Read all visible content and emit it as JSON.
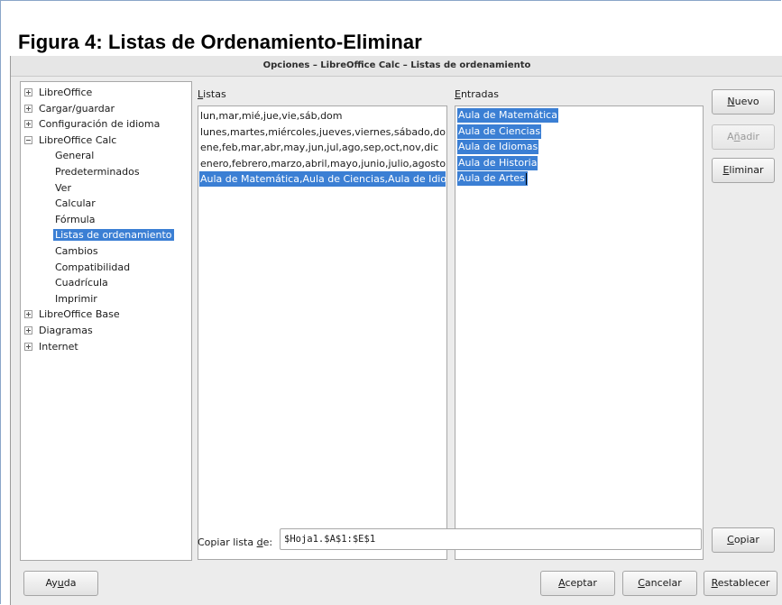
{
  "caption": "Figura 4: Listas de Ordenamiento-Eliminar",
  "window": {
    "title": "Opciones – LibreOffice Calc – Listas de ordenamiento"
  },
  "tree": {
    "items": [
      {
        "label": "LibreOffice",
        "expander": "plus"
      },
      {
        "label": "Cargar/guardar",
        "expander": "plus"
      },
      {
        "label": "Configuración de idioma",
        "expander": "plus"
      },
      {
        "label": "LibreOffice Calc",
        "expander": "minus"
      },
      {
        "label": "General"
      },
      {
        "label": "Predeterminados"
      },
      {
        "label": "Ver"
      },
      {
        "label": "Calcular"
      },
      {
        "label": "Fórmula"
      },
      {
        "label": "Listas de ordenamiento",
        "selected": true
      },
      {
        "label": "Cambios"
      },
      {
        "label": "Compatibilidad"
      },
      {
        "label": "Cuadrícula"
      },
      {
        "label": "Imprimir"
      },
      {
        "label": "LibreOffice Base",
        "expander": "plus"
      },
      {
        "label": "Diagramas",
        "expander": "plus"
      },
      {
        "label": "Internet",
        "expander": "plus"
      }
    ]
  },
  "lists": {
    "label_mnemonic": "L",
    "label_rest": "istas",
    "items": [
      "lun,mar,mié,jue,vie,sáb,dom",
      "lunes,martes,miércoles,jueves,viernes,sábado,domingo",
      "ene,feb,mar,abr,may,jun,jul,ago,sep,oct,nov,dic",
      "enero,febrero,marzo,abril,mayo,junio,julio,agosto,septiembre,octubre,noviembre,diciembre",
      "Aula de Matemática,Aula de Ciencias,Aula de Idiomas,Aula de Historia,Aula de Artes"
    ],
    "selected_index": 4
  },
  "entries": {
    "label_mnemonic": "E",
    "label_rest": "ntradas",
    "items": [
      "Aula de Matemática",
      "Aula de Ciencias",
      "Aula de Idiomas",
      "Aula de Historia",
      "Aula de Artes"
    ]
  },
  "buttons": {
    "new_mn": "N",
    "new_rest": "uevo",
    "add_pre": "A",
    "add_mn": "ñ",
    "add_rest": "adir",
    "delete_mn": "E",
    "delete_rest": "liminar",
    "copy_mn": "C",
    "copy_rest": "opiar",
    "help_pre": "Ay",
    "help_mn": "u",
    "help_rest": "da",
    "ok_mn": "A",
    "ok_rest": "ceptar",
    "cancel_mn": "C",
    "cancel_rest": "ancelar",
    "reset_mn": "R",
    "reset_rest": "establecer"
  },
  "copy_from": {
    "label_pre": "Copiar lista ",
    "label_mn": "d",
    "label_rest": "e:",
    "value": "$Hoja1.$A$1:$E$1"
  }
}
